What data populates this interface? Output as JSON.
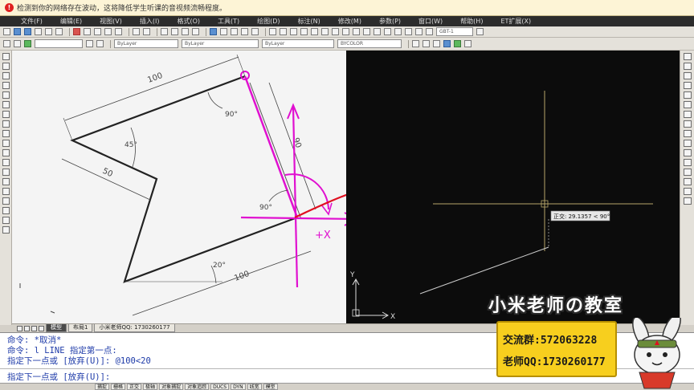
{
  "notification": {
    "text": "检测到你的网络存在波动，这将降低学生听课的音视频流畅程度。"
  },
  "menu": {
    "items": [
      "文件(F)",
      "编辑(E)",
      "视图(V)",
      "插入(I)",
      "格式(O)",
      "工具(T)",
      "绘图(D)",
      "标注(N)",
      "修改(M)",
      "参数(P)",
      "窗口(W)",
      "帮助(H)",
      "ET扩展(X)"
    ]
  },
  "toolbar": {
    "layer_combo": "ByLayer",
    "linetype_combo": "ByLayer",
    "lineweight_combo": "ByLayer",
    "color_combo": "BYCOLOR",
    "dimstyle_combo": "GBT-1"
  },
  "drawing": {
    "dim_top": "100",
    "dim_angle_90": "90°",
    "dim_angle_45": "45°",
    "dim_left": "50",
    "dim_right": "90",
    "dim_angle_90b": "90°",
    "dim_angle_20": "20°",
    "dim_bottom": "100"
  },
  "annotation": {
    "plus_x": "+X"
  },
  "canvas": {
    "tooltip": "正交: 29.1357 < 90°",
    "ucs_y": "Y",
    "ucs_x": "X"
  },
  "tabs": {
    "items": [
      "模型",
      "布局1",
      "小米老师QQ: 1730260177"
    ],
    "active_index": 0
  },
  "command": {
    "line1": "命令: *取消*",
    "line2": "命令: l LINE 指定第一点:",
    "line3": "指定下一点或 [放弃(U)]: @100<20",
    "line4": "指定下一点或 [放弃(U)]:"
  },
  "status": {
    "items": [
      "捕捉",
      "栅格",
      "正交",
      "极轴",
      "对象捕捉",
      "对象追踪",
      "DUCS",
      "DYN",
      "线宽",
      "模型"
    ]
  },
  "promo": {
    "title": "小米老师の教室",
    "group": "交流群:572063228",
    "qq": "老师QQ:1730260177"
  },
  "colors": {
    "accent_magenta": "#e010d0",
    "accent_red": "#e01020",
    "promo_yellow": "#f7cf1e"
  }
}
